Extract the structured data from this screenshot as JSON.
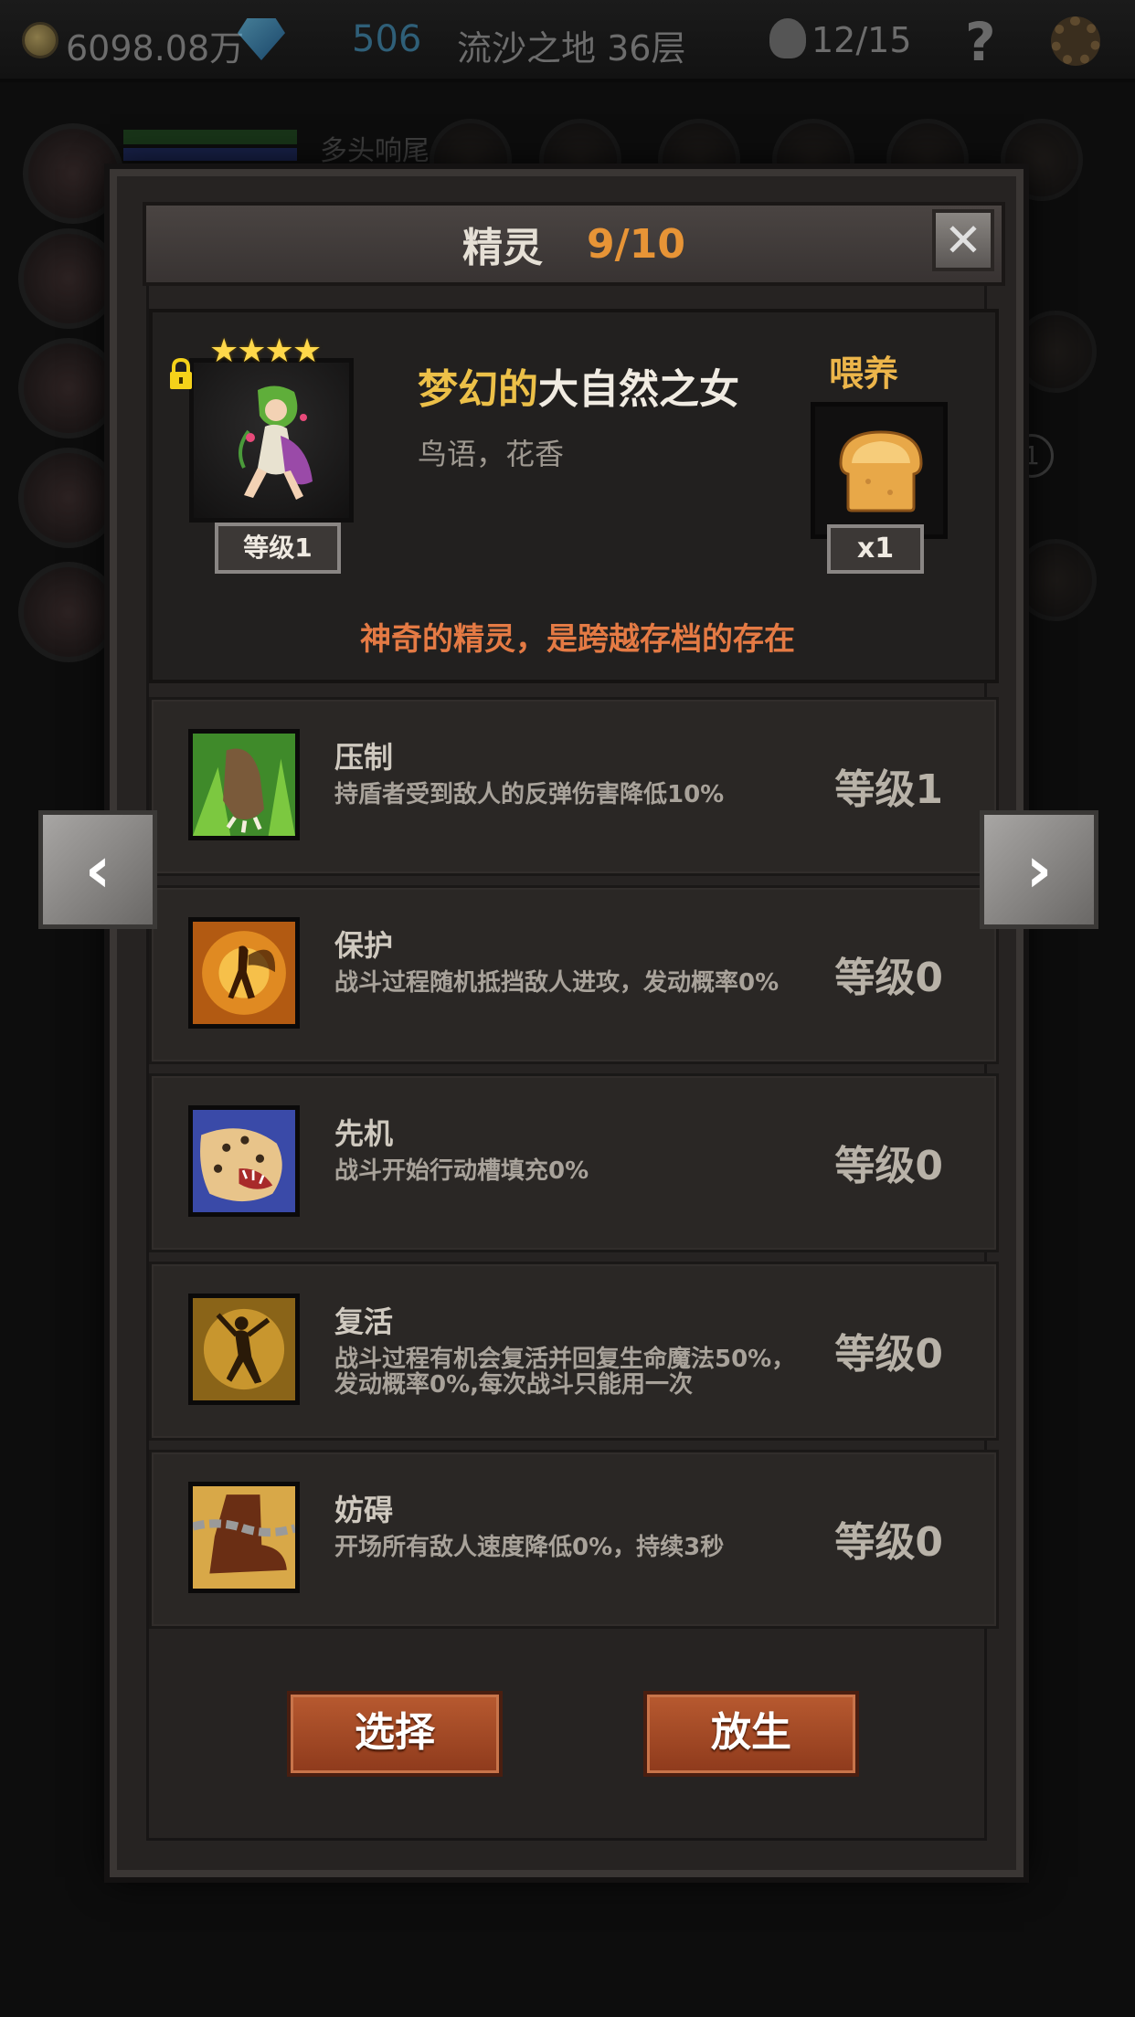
{
  "topbar": {
    "gold": "6098.08万",
    "diamonds": "506",
    "stage": "流沙之地 36层",
    "kills": "12/15",
    "help": "?",
    "icons": [
      "coin-icon",
      "diamond-icon",
      "skull-icon",
      "help-icon",
      "settings-gear-icon"
    ]
  },
  "background": {
    "partial_text": "多头响尾",
    "badge": "1"
  },
  "dialog": {
    "title": "精灵",
    "count": "9/10",
    "close": "✕"
  },
  "hero": {
    "stars": "★★★★",
    "level": "等级1",
    "name_highlight": "梦幻的",
    "name_rest": "大自然之女",
    "subtitle": "鸟语，花香",
    "feed_label": "喂养",
    "feed_qty": "x1",
    "description": "神奇的精灵，是跨越存档的存在"
  },
  "skills": [
    {
      "name": "压制",
      "desc": "持盾者受到敌人的反弹伤害降低10%",
      "level": "等级1",
      "icon": "beast-claw-icon"
    },
    {
      "name": "保护",
      "desc": "战斗过程随机抵挡敌人进攻，发动概率0%",
      "level": "等级0",
      "icon": "fairy-shield-icon"
    },
    {
      "name": "先机",
      "desc": "战斗开始行动槽填充0%",
      "level": "等级0",
      "icon": "leopard-icon"
    },
    {
      "name": "复活",
      "desc": "战斗过程有机会复活并回复生命魔法50%，发动概率0%,每次战斗只能用一次",
      "level": "等级0",
      "icon": "revive-dancer-icon"
    },
    {
      "name": "妨碍",
      "desc": "开场所有敌人速度降低0%，持续3秒",
      "level": "等级0",
      "icon": "chained-boot-icon"
    }
  ],
  "buttons": {
    "select": "选择",
    "release": "放生"
  },
  "nav": {
    "prev": "‹",
    "next": "›"
  }
}
